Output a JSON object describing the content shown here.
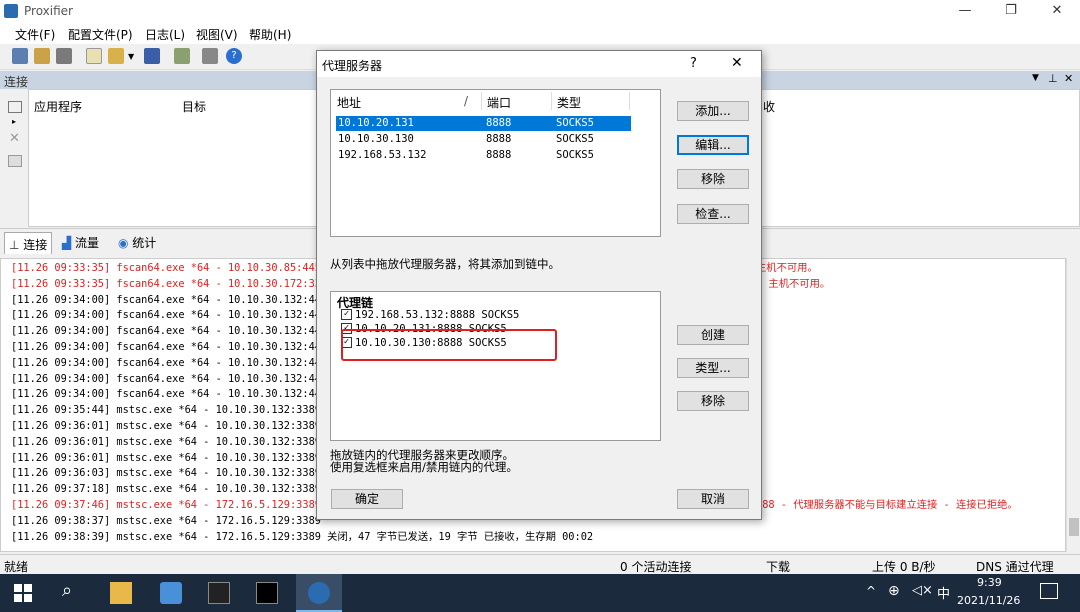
{
  "app": {
    "title": "Proxifier"
  },
  "menu": [
    "文件(F)",
    "配置文件(P)",
    "日志(L)",
    "视图(V)",
    "帮助(H)"
  ],
  "connections": {
    "header": "连接",
    "columns": [
      "应用程序",
      "目标",
      "收"
    ]
  },
  "tabs": [
    "连接",
    "流量",
    "统计"
  ],
  "log": [
    {
      "text": "[11.26 09:33:35] fscan64.exe *64 - 10.10.30.85:445",
      "tail": "主机不可用。",
      "red": true
    },
    {
      "text": "[11.26 09:33:35] fscan64.exe *64 - 10.10.30.172:3389",
      "tail": "- 主机不可用。",
      "red": true
    },
    {
      "text": "[11.26 09:34:00] fscan64.exe *64 - 10.10.30.132:445",
      "tail": "",
      "red": false
    },
    {
      "text": "[11.26 09:34:00] fscan64.exe *64 - 10.10.30.132:445",
      "tail": "",
      "red": false
    },
    {
      "text": "[11.26 09:34:00] fscan64.exe *64 - 10.10.30.132:445",
      "tail": "",
      "red": false
    },
    {
      "text": "[11.26 09:34:00] fscan64.exe *64 - 10.10.30.132:445",
      "tail": "",
      "red": false
    },
    {
      "text": "[11.26 09:34:00] fscan64.exe *64 - 10.10.30.132:445",
      "tail": "",
      "red": false
    },
    {
      "text": "[11.26 09:34:00] fscan64.exe *64 - 10.10.30.132:445",
      "tail": "",
      "red": false
    },
    {
      "text": "[11.26 09:34:00] fscan64.exe *64 - 10.10.30.132:445",
      "tail": "",
      "red": false
    },
    {
      "text": "[11.26 09:35:44] mstsc.exe *64 - 10.10.30.132:3389",
      "tail": "",
      "red": false
    },
    {
      "text": "[11.26 09:36:01] mstsc.exe *64 - 10.10.30.132:3389",
      "tail": "",
      "red": false
    },
    {
      "text": "[11.26 09:36:01] mstsc.exe *64 - 10.10.30.132:3389",
      "tail": "",
      "red": false
    },
    {
      "text": "[11.26 09:36:01] mstsc.exe *64 - 10.10.30.132:3389",
      "tail": "",
      "red": false
    },
    {
      "text": "[11.26 09:36:03] mstsc.exe *64 - 10.10.30.132:3389",
      "tail": "",
      "red": false
    },
    {
      "text": "[11.26 09:37:18] mstsc.exe *64 - 10.10.30.132:3389",
      "tail": "5",
      "red": false
    },
    {
      "text": "[11.26 09:37:46] mstsc.exe *64 - 172.16.5.129:3389",
      "tail": "388 - 代理服务器不能与目标建立连接 - 连接已拒绝。",
      "red": true
    },
    {
      "text": "[11.26 09:38:37] mstsc.exe *64 - 172.16.5.129:3389",
      "tail": "",
      "red": false
    },
    {
      "text": "[11.26 09:38:39] mstsc.exe *64 - 172.16.5.129:3389 关闭，47 字节已发送，19 字节 已接收，生存期 00:02",
      "tail": "",
      "red": false
    }
  ],
  "status": {
    "ready": "就绪",
    "active": "0 个活动连接",
    "download": "下载",
    "upload": "上传 0 B/秒",
    "dns": "DNS 通过代理"
  },
  "dialog": {
    "title": "代理服务器",
    "help": "?",
    "close": "✕",
    "list_headers": {
      "address": "地址",
      "sort": "/",
      "port": "端口",
      "type": "类型"
    },
    "proxies": [
      {
        "address": "10.10.20.131",
        "port": "8888",
        "type": "SOCKS5",
        "selected": true
      },
      {
        "address": "10.10.30.130",
        "port": "8888",
        "type": "SOCKS5",
        "selected": false
      },
      {
        "address": "192.168.53.132",
        "port": "8888",
        "type": "SOCKS5",
        "selected": false
      }
    ],
    "buttons": {
      "add": "添加...",
      "edit": "编辑...",
      "remove": "移除",
      "check": "检查...",
      "create": "创建",
      "type": "类型...",
      "remove2": "移除",
      "ok": "确定",
      "cancel": "取消"
    },
    "drag_hint": "从列表中拖放代理服务器，将其添加到链中。",
    "chain_title": "代理链",
    "chain": [
      "192.168.53.132:8888 SOCKS5",
      "10.10.20.131:8888 SOCKS5",
      "10.10.30.130:8888 SOCKS5"
    ],
    "hint_line1": "拖放链内的代理服务器来更改顺序。",
    "hint_line2": "使用复选框来启用/禁用链内的代理。"
  },
  "taskbar": {
    "ime": "中",
    "time": "9:39",
    "date": "2021/11/26"
  }
}
